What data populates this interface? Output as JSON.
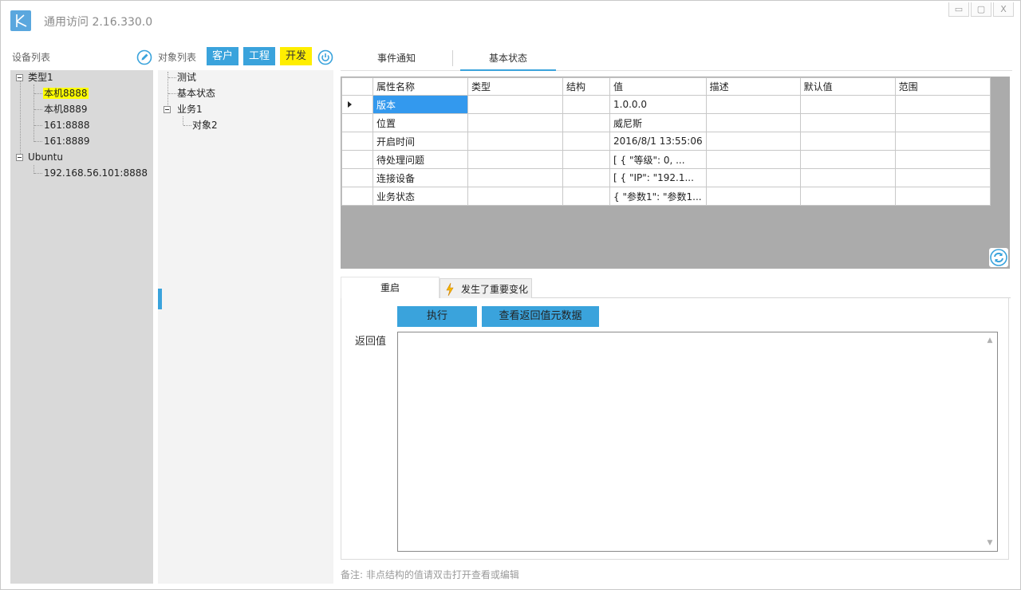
{
  "app": {
    "title": "通用访问 2.16.330.0",
    "logo": "k-logo-icon"
  },
  "window_controls": {
    "minimize": "▭",
    "restore": "▢",
    "close": "X"
  },
  "left": {
    "devices_label": "设备列表",
    "objects_label": "对象列表",
    "tag_kehu": "客户",
    "tag_gongcheng": "工程",
    "tag_kaifa": "开发",
    "device_tree": {
      "group1": "类型1",
      "items1": [
        "本机8888",
        "本机8889",
        "161:8888",
        "161:8889"
      ],
      "group2": "Ubuntu",
      "items2": [
        "192.168.56.101:8888"
      ]
    },
    "object_tree": {
      "item_test": "测试",
      "item_status": "基本状态",
      "group_biz": "业务1",
      "item_obj2": "对象2"
    }
  },
  "tabs": {
    "event": "事件通知",
    "status": "基本状态"
  },
  "grid": {
    "headers": [
      "属性名称",
      "类型",
      "结构",
      "值",
      "描述",
      "默认值",
      "范围"
    ],
    "rows": [
      [
        "版本",
        "",
        "",
        "1.0.0.0",
        "",
        "",
        ""
      ],
      [
        "位置",
        "",
        "",
        "威尼斯",
        "",
        "",
        ""
      ],
      [
        "开启时间",
        "",
        "",
        "2016/8/1 13:55:06",
        "",
        "",
        ""
      ],
      [
        "待处理问题",
        "",
        "",
        "[  {    \"等级\": 0,     ...",
        "",
        "",
        ""
      ],
      [
        "连接设备",
        "",
        "",
        "[  {    \"IP\": \"192.1...",
        "",
        "",
        ""
      ],
      [
        "业务状态",
        "",
        "",
        "{  \"参数1\": \"参数1...",
        "",
        "",
        ""
      ]
    ]
  },
  "method_tabs": {
    "restart": "重启",
    "changed": "发生了重要变化"
  },
  "method": {
    "execute": "执行",
    "view_meta": "查看返回值元数据",
    "return_label": "返回值",
    "return_value": ""
  },
  "note": "备注: 非点结构的值请双击打开查看或编辑",
  "colors": {
    "accent": "#3aa3dc",
    "highlight": "#ffff00",
    "selection": "#3399ee"
  }
}
